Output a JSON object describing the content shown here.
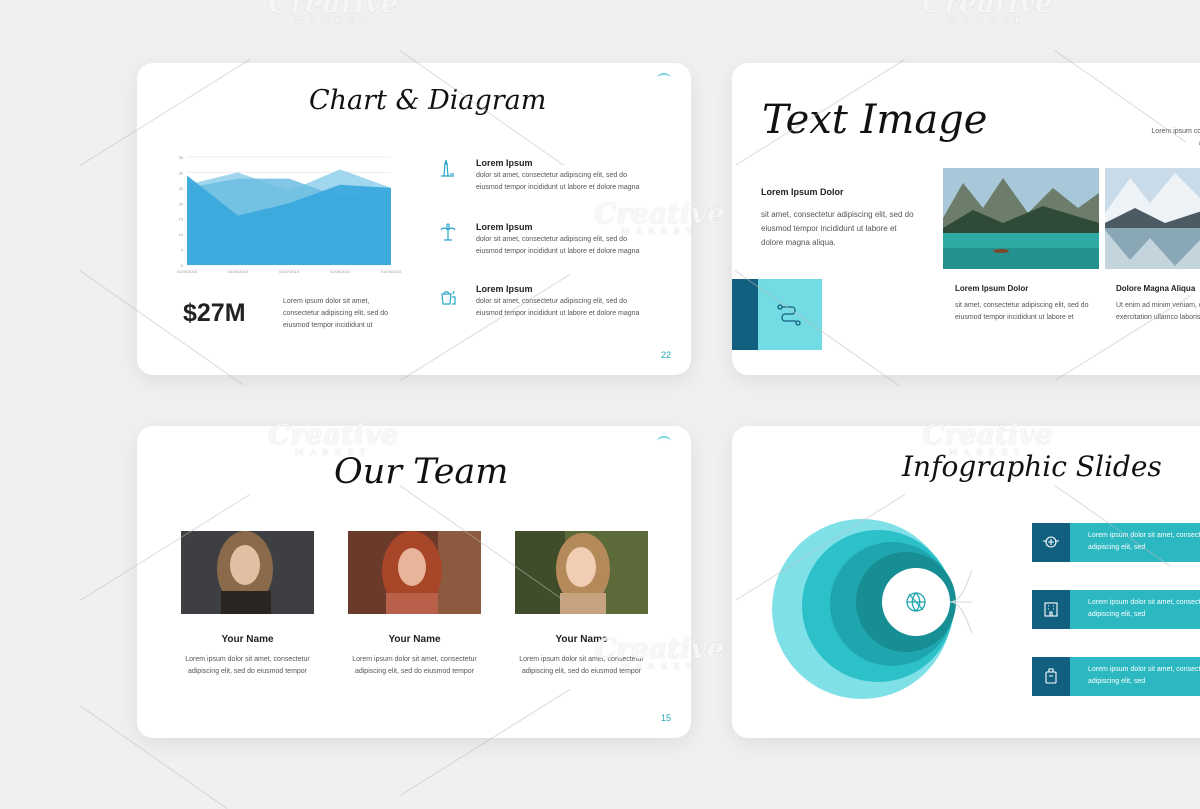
{
  "slides": {
    "chart": {
      "title": "Chart & Diagram",
      "stat": "$27M",
      "stat_text": "Lorem ipsum dolor sit amet, consectetur adipiscing elit, sed do eiusmod tempor incididunt ut",
      "items": [
        {
          "heading": "Lorem Ipsum",
          "text": "dolor sit amet, consectetur adipiscing elit, sed do eiusmod tempor incididunt ut labore et dolore magna",
          "icon": "lighthouse-icon"
        },
        {
          "heading": "Lorem Ipsum",
          "text": "dolor sit amet, consectetur adipiscing elit, sed do eiusmod tempor incididunt ut labore et dolore magna",
          "icon": "palm-tree-icon"
        },
        {
          "heading": "Lorem Ipsum",
          "text": "dolor sit amet, consectetur adipiscing elit, sed do eiusmod tempor incididunt ut labore et dolore magna",
          "icon": "bucket-icon"
        }
      ],
      "page": "22"
    },
    "text_image": {
      "title": "Text Image",
      "corner_text": "Lorem ipsum consectetur adipiscing",
      "heading": "Lorem Ipsum Dolor",
      "body": "sit amet, consectetur adipiscing elit, sed do eiusmod tempor incididunt ut labore et dolore magna aliqua.",
      "icon": "route-icon",
      "captions": [
        {
          "heading": "Lorem Ipsum Dolor",
          "text": "sit amet, consectetur adipiscing elit, sed do eiusmod tempor incididunt ut labore et"
        },
        {
          "heading": "Dolore Magna Aliqua",
          "text": "Ut enim ad minim veniam, quis exercitation ullamco laboris"
        }
      ]
    },
    "team": {
      "title": "Our Team",
      "members": [
        {
          "name": "Your Name",
          "text": "Lorem ipsum dolor sit amet, consectetur adipiscing elit, sed do eiusmod tempor"
        },
        {
          "name": "Your Name",
          "text": "Lorem ipsum dolor sit amet, consectetur adipiscing elit, sed do eiusmod tempor"
        },
        {
          "name": "Your Name",
          "text": "Lorem ipsum dolor sit amet, consectetur adipiscing elit, sed do eiusmod tempor"
        }
      ],
      "page": "15"
    },
    "infographic": {
      "title": "Infographic Slides",
      "center_icon": "globe-icon",
      "items": [
        {
          "text": "Lorem ipsum dolor sit amet, consectetur adipiscing elit, sed",
          "icon": "plane-badge-icon"
        },
        {
          "text": "Lorem ipsum dolor sit amet, consectetur adipiscing elit, sed",
          "icon": "hotel-icon"
        },
        {
          "text": "Lorem ipsum dolor sit amet, consectetur adipiscing elit, sed",
          "icon": "luggage-icon"
        }
      ]
    }
  },
  "chart_data": {
    "type": "area",
    "categories": [
      "01/05/2015",
      "01/06/2015",
      "01/07/2015",
      "01/08/2015",
      "01/09/2015"
    ],
    "series": [
      {
        "values": [
          26,
          30,
          24,
          31,
          25
        ],
        "color": "#8fd0ec"
      },
      {
        "values": [
          25,
          28,
          28,
          22,
          24
        ],
        "color": "#6bbde0"
      },
      {
        "values": [
          29,
          16,
          20,
          26,
          25
        ],
        "color": "#3aa9dd"
      }
    ],
    "ylim": [
      0,
      35
    ],
    "yticks": [
      "0",
      "5",
      "10",
      "15",
      "20",
      "25",
      "30",
      "35"
    ],
    "grid": true
  },
  "watermark": {
    "brand": "Creative",
    "sub": "MARKET"
  }
}
